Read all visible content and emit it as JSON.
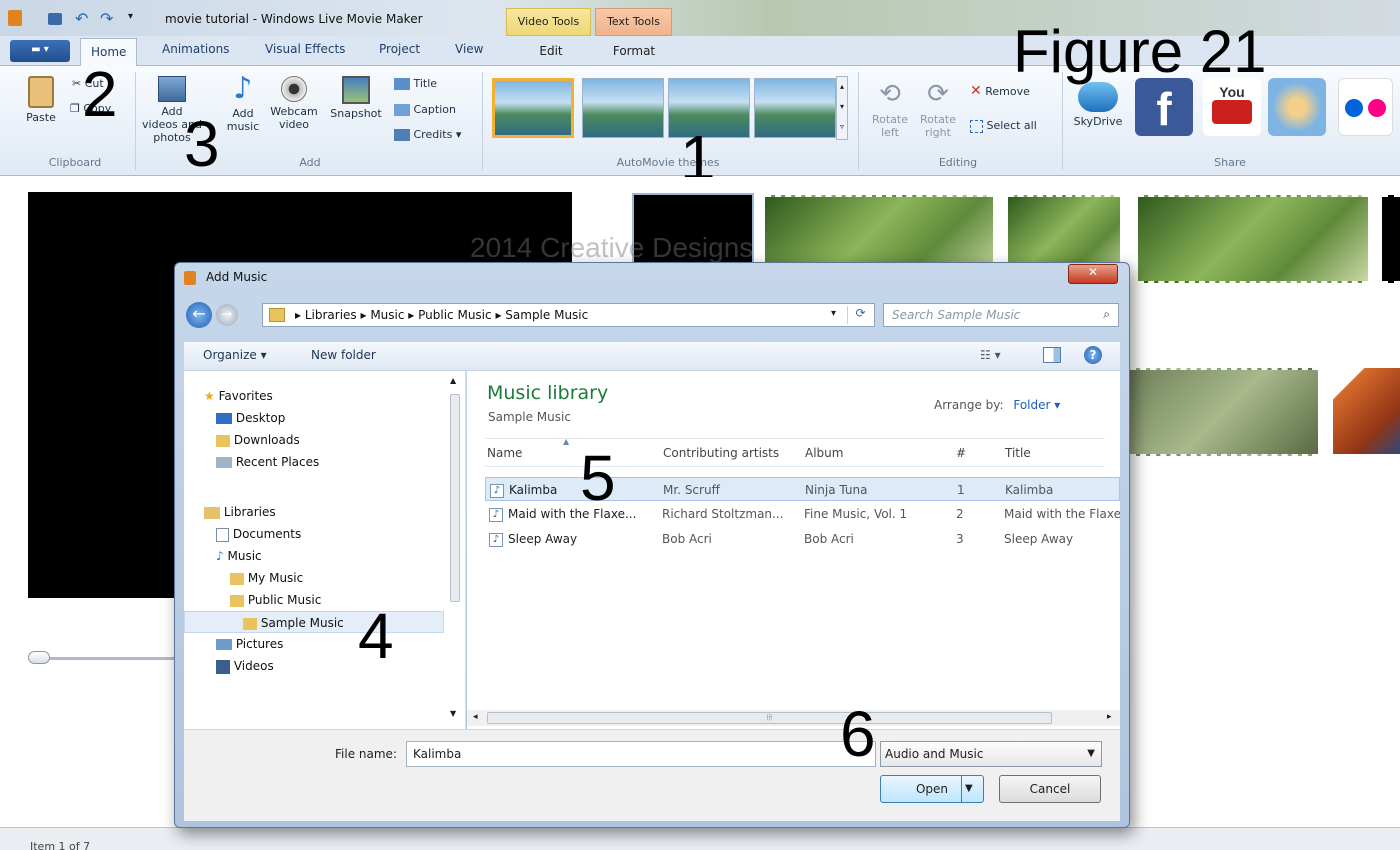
{
  "window": {
    "title": "movie tutorial - Windows Live Movie Maker"
  },
  "context_tabs": {
    "video_tools": "Video Tools",
    "text_tools": "Text Tools"
  },
  "tabs": [
    "Home",
    "Animations",
    "Visual Effects",
    "Project",
    "View",
    "Edit",
    "Format"
  ],
  "ribbon": {
    "clipboard": {
      "paste": "Paste",
      "cut": "Cut",
      "copy": "Copy",
      "label": "Clipboard"
    },
    "add": {
      "add_videos": "Add videos and photos",
      "add_music": "Add music",
      "webcam": "Webcam video",
      "snapshot": "Snapshot",
      "title": "Title",
      "caption": "Caption",
      "credits": "Credits",
      "label": "Add"
    },
    "automovie": {
      "label": "AutoMovie themes"
    },
    "editing": {
      "rotate_left": "Rotate left",
      "rotate_right": "Rotate right",
      "remove": "Remove",
      "select_all": "Select all",
      "label": "Editing"
    },
    "share": {
      "skydrive": "SkyDrive",
      "label": "Share"
    }
  },
  "annotations": {
    "figure": "Figure 21",
    "n1": "1",
    "n2": "2",
    "n3": "3",
    "n4": "4",
    "n5": "5",
    "n6": "6"
  },
  "watermark": "2014 Creative Designs",
  "status": {
    "text": "Item 1 of 7"
  },
  "dialog": {
    "title": "Add Music",
    "breadcrumbs": [
      "Libraries",
      "Music",
      "Public Music",
      "Sample Music"
    ],
    "search_placeholder": "Search Sample Music",
    "toolbar": {
      "organize": "Organize",
      "new_folder": "New folder"
    },
    "nav": [
      {
        "label": "Favorites",
        "level": 0,
        "icon": "star-icon"
      },
      {
        "label": "Desktop",
        "level": 1,
        "icon": "desktop-icon"
      },
      {
        "label": "Downloads",
        "level": 1,
        "icon": "folder-icon"
      },
      {
        "label": "Recent Places",
        "level": 1,
        "icon": "recent-icon"
      },
      {
        "label": "Libraries",
        "level": 0,
        "icon": "library-icon"
      },
      {
        "label": "Documents",
        "level": 1,
        "icon": "document-icon"
      },
      {
        "label": "Music",
        "level": 1,
        "icon": "music-icon"
      },
      {
        "label": "My Music",
        "level": 2,
        "icon": "folder-icon"
      },
      {
        "label": "Public Music",
        "level": 2,
        "icon": "folder-icon"
      },
      {
        "label": "Sample Music",
        "level": 3,
        "icon": "folder-icon"
      },
      {
        "label": "Pictures",
        "level": 1,
        "icon": "pictures-icon"
      },
      {
        "label": "Videos",
        "level": 1,
        "icon": "videos-icon"
      }
    ],
    "library": {
      "title": "Music library",
      "subtitle": "Sample Music",
      "arrange_label": "Arrange by:",
      "arrange_value": "Folder"
    },
    "columns": [
      "Name",
      "Contributing artists",
      "Album",
      "#",
      "Title"
    ],
    "files": [
      {
        "name": "Kalimba",
        "artist": "Mr. Scruff",
        "album": "Ninja Tuna",
        "num": "1",
        "title": "Kalimba"
      },
      {
        "name": "Maid with the Flaxe...",
        "artist": "Richard Stoltzman...",
        "album": "Fine Music, Vol. 1",
        "num": "2",
        "title": "Maid with the Flaxe"
      },
      {
        "name": "Sleep Away",
        "artist": "Bob Acri",
        "album": "Bob Acri",
        "num": "3",
        "title": "Sleep Away"
      }
    ],
    "filename_label": "File name:",
    "filename_value": "Kalimba",
    "filetype": "Audio and Music",
    "open": "Open",
    "cancel": "Cancel"
  }
}
